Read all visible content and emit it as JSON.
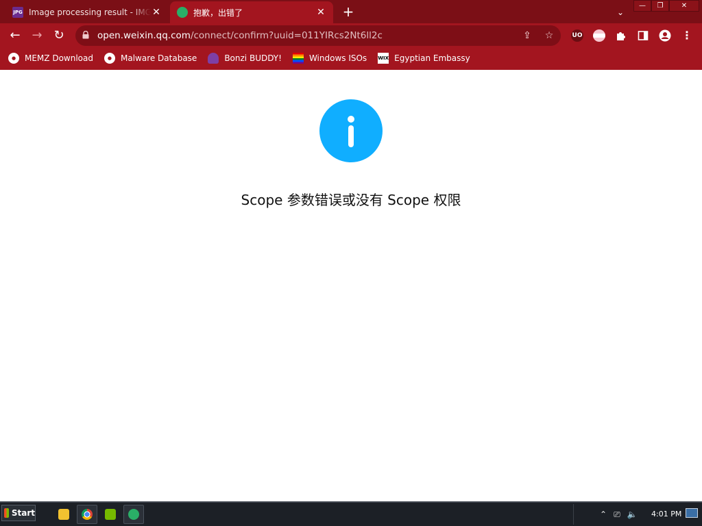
{
  "tabs": [
    {
      "title": "Image processing result - IMG online",
      "favicon": "jpg-icon",
      "close": "✕"
    },
    {
      "title": "抱歉，出错了",
      "favicon": "wechat-icon",
      "close": "✕"
    }
  ],
  "tab_controls": {
    "new_tab": "+",
    "tab_search": "⌄"
  },
  "window_controls": {
    "minimize": "—",
    "restore": "❐",
    "close": "✕"
  },
  "toolbar": {
    "back": "←",
    "forward": "→",
    "reload": "↻",
    "url_host": "open.weixin.qq.com",
    "url_path": "/connect/confirm?uuid=011YIRcs2Nt6ll2c",
    "share_icon": "⇪",
    "star_icon": "☆",
    "extensions": [
      "ublock-origin-icon",
      "flag-extension-icon",
      "puzzle-icon",
      "sidepanel-icon",
      "profile-icon",
      "menu-icon"
    ],
    "ublock_label": "UO",
    "menu_label": "⋮"
  },
  "bookmarks": [
    {
      "label": "MEMZ Download",
      "icon": "globe-icon"
    },
    {
      "label": "Malware Database",
      "icon": "globe-icon"
    },
    {
      "label": "Bonzi BUDDY!",
      "icon": "bonzi-icon"
    },
    {
      "label": "Windows ISOs",
      "icon": "rainbow-flag-icon"
    },
    {
      "label": "Egyptian Embassy",
      "icon": "wix-icon"
    }
  ],
  "bookmark_glyphs": {
    "globe": "●",
    "wix": "WIX"
  },
  "page": {
    "icon": "info-icon",
    "message": "Scope 参数错误或没有 Scope 权限",
    "accent": "#10aeff"
  },
  "taskbar": {
    "start_label": "Start",
    "apps": [
      "folder-icon",
      "chrome-icon",
      "nvidia-icon",
      "wechat-icon"
    ],
    "tray_icons": {
      "up": "⌃",
      "network": "⎚",
      "volume": "🔈"
    },
    "clock": "4:01 PM"
  },
  "colors": {
    "tab_strip": "#7b0f16",
    "toolbar": "#a3151f",
    "omnibox": "#7e0e16",
    "taskbar": "#1c2026"
  }
}
